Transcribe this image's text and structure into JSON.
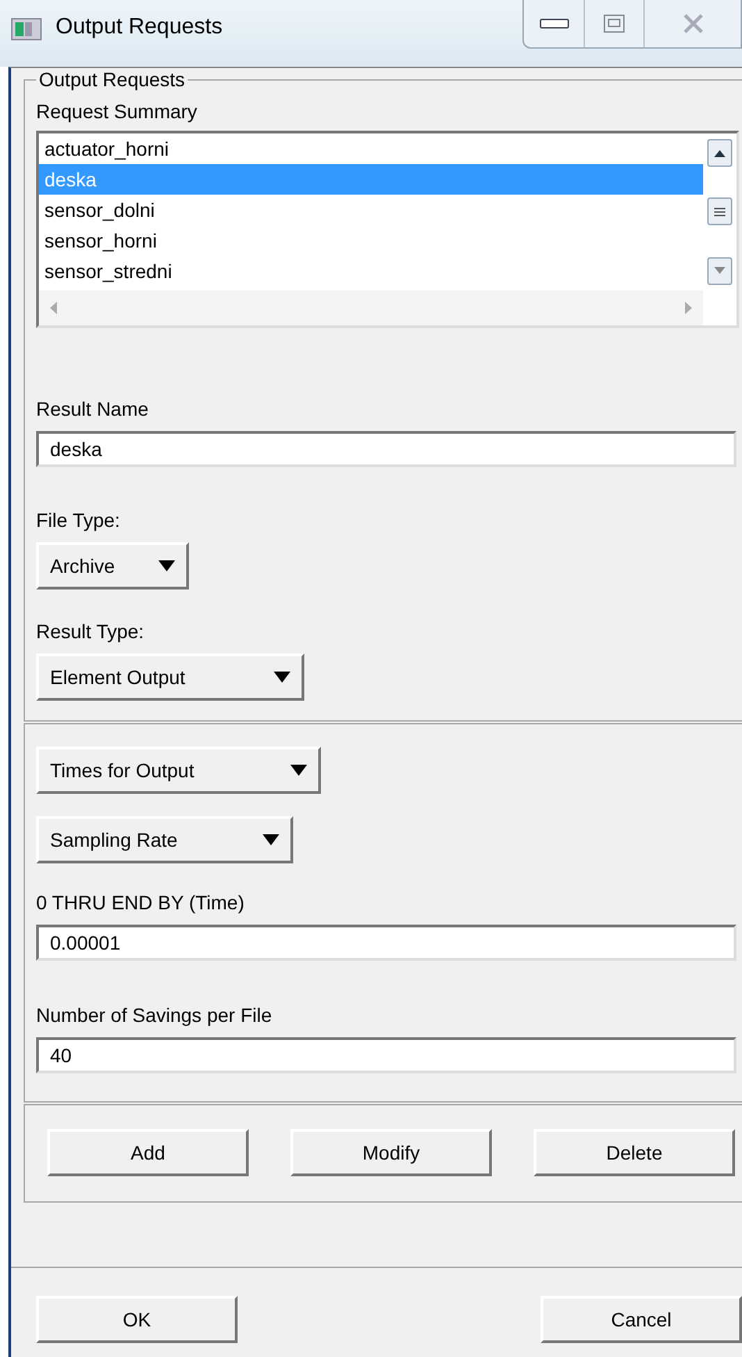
{
  "window": {
    "title": "Output Requests"
  },
  "group": {
    "legend": "Output Requests",
    "list_label": "Request Summary",
    "items": [
      {
        "label": "actuator_horni",
        "selected": false
      },
      {
        "label": "deska",
        "selected": true
      },
      {
        "label": "sensor_dolni",
        "selected": false
      },
      {
        "label": "sensor_horni",
        "selected": false
      },
      {
        "label": "sensor_stredni",
        "selected": false
      }
    ]
  },
  "result_name": {
    "label": "Result Name",
    "value": "deska"
  },
  "file_type": {
    "label": "File Type:",
    "value": "Archive"
  },
  "result_type": {
    "label": "Result Type:",
    "value": "Element Output"
  },
  "times_dropdown": {
    "value": "Times for Output"
  },
  "rate_dropdown": {
    "value": "Sampling Rate"
  },
  "interval": {
    "label": "0 THRU END BY (Time)",
    "value": "0.00001"
  },
  "savings": {
    "label": "Number of Savings per File",
    "value": "40"
  },
  "action_buttons": [
    "Add",
    "Modify",
    "Delete"
  ],
  "footer_buttons": [
    "OK",
    "Cancel"
  ]
}
